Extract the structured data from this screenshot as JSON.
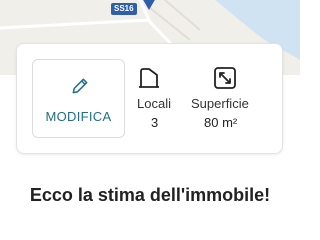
{
  "map": {
    "road_label": "SS16"
  },
  "summary": {
    "edit_label": "MODIFICA",
    "rooms": {
      "label": "Locali",
      "value": "3"
    },
    "area": {
      "label": "Superficie",
      "value": "80 m²"
    }
  },
  "icons": {
    "edit": "pencil-icon",
    "rooms": "door-icon",
    "area": "expand-arrows-icon"
  },
  "colors": {
    "accent": "#1f6f8b",
    "map_background": "#f1efea",
    "water": "#cfe3f2",
    "road_marker": "#2f5fa8"
  },
  "headline": "Ecco la stima dell'immobile!"
}
